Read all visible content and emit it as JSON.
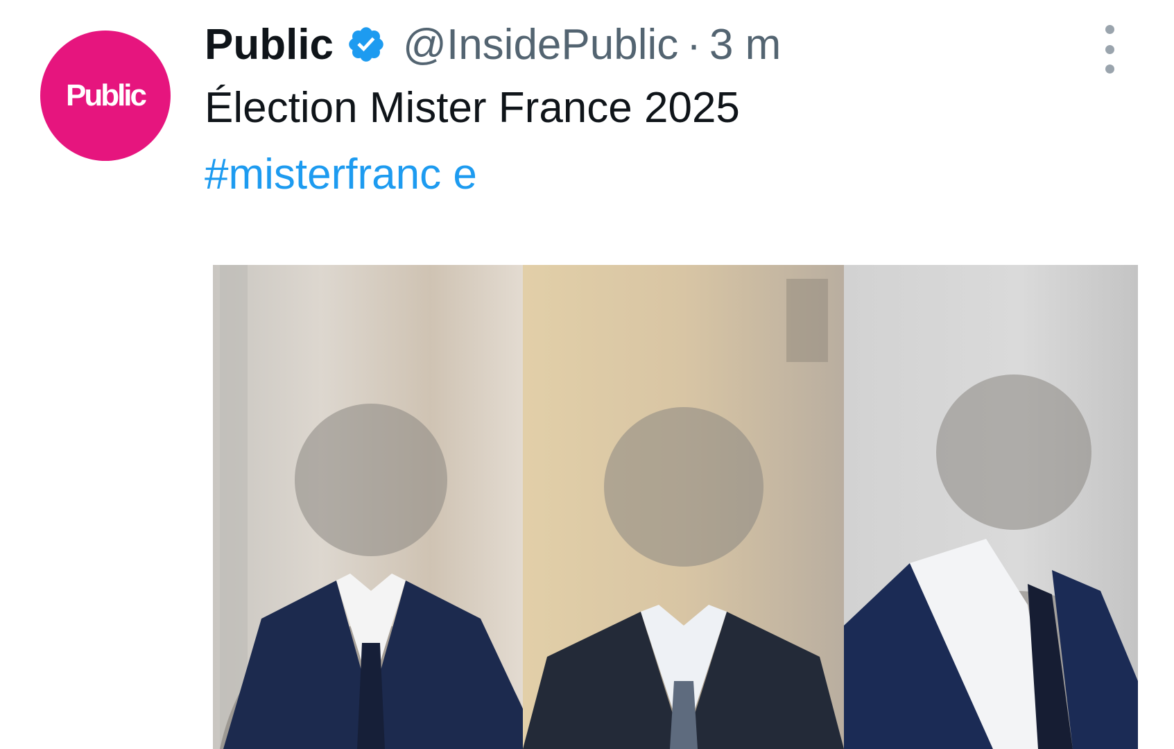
{
  "post": {
    "author_name": "Public",
    "avatar_text": "Public",
    "handle": "@InsidePublic",
    "separator": "·",
    "time": "3 m",
    "text": "Élection Mister France 2025",
    "hashtag": "#misterfranc e"
  },
  "icons": {
    "verified": "verified-badge-icon",
    "menu": "more-options-icon"
  },
  "colors": {
    "avatar_bg": "#e6157e",
    "link": "#1d9bf0",
    "verified": "#1d9bf0",
    "muted_text": "#536471"
  }
}
